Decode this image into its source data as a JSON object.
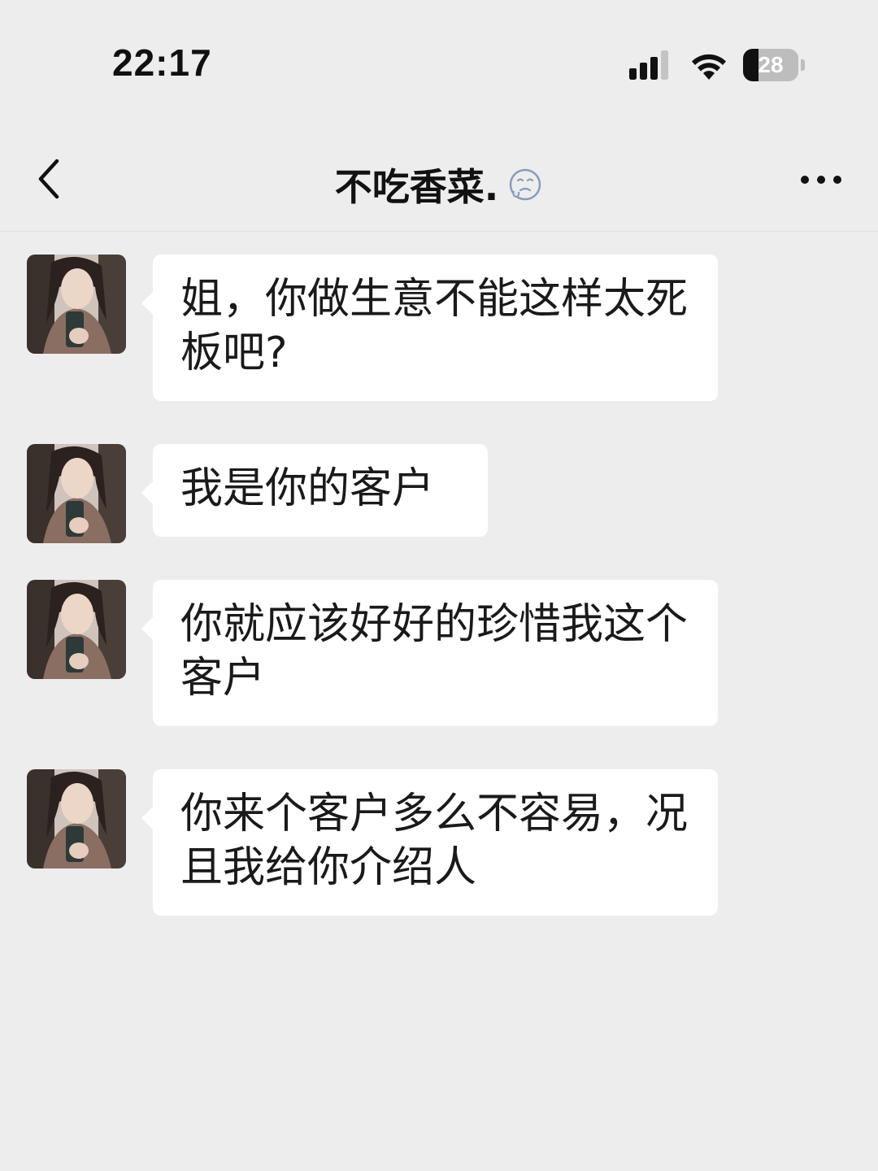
{
  "status_bar": {
    "time": "22:17",
    "battery_level": "28",
    "battery_fraction": 0.28,
    "icons": [
      "signal-icon",
      "wifi-icon",
      "battery-icon"
    ]
  },
  "nav": {
    "back_icon": "chevron-left-icon",
    "title": "不吃香菜.",
    "title_icon": "status-emoji-icon",
    "more_icon": "more-dots-icon"
  },
  "messages": [
    {
      "sender": "contact",
      "text": "姐，你做生意不能这样太死板吧?"
    },
    {
      "sender": "contact",
      "text": "我是你的客户"
    },
    {
      "sender": "contact",
      "text": "你就应该好好的珍惜我这个客户"
    },
    {
      "sender": "contact",
      "text": "你来个客户多么不容易，况且我给你介绍人"
    }
  ],
  "colors": {
    "background": "#ededed",
    "bubble": "#ffffff",
    "text": "#1a1a1a"
  }
}
